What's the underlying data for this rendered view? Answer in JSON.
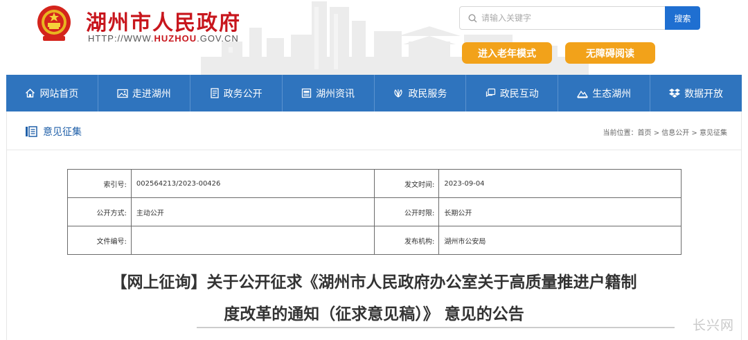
{
  "header": {
    "site_title": "湖州市人民政府",
    "url_prefix": "HTTP://WWW.",
    "url_domain": "HUZHOU",
    "url_suffix": ".GOV.CN",
    "search_placeholder": "请输入关键字",
    "search_button": "搜索",
    "elder_mode": "进入老年模式",
    "accessible_mode": "无障碍阅读",
    "brand_color": "#c8161d",
    "accent_color": "#f2a21a"
  },
  "nav": {
    "color": "#2f74be",
    "items": [
      {
        "label": "网站首页",
        "icon": "home-icon"
      },
      {
        "label": "走进湖州",
        "icon": "picture-icon"
      },
      {
        "label": "政务公开",
        "icon": "document-icon"
      },
      {
        "label": "湖州资讯",
        "icon": "news-icon"
      },
      {
        "label": "政民服务",
        "icon": "service-icon"
      },
      {
        "label": "政民互动",
        "icon": "chat-icon"
      },
      {
        "label": "生态湖州",
        "icon": "mountain-icon"
      },
      {
        "label": "数据开放",
        "icon": "dropbox-icon"
      }
    ]
  },
  "section": {
    "title": "意见征集",
    "breadcrumb": "当前位置：首页 > 信息公开 > 意见征集"
  },
  "meta_table": {
    "rows": [
      {
        "label1": "索引号:",
        "value1": "002564213/2023-00426",
        "label2": "发文时间:",
        "value2": "2023-09-04"
      },
      {
        "label1": "公开方式:",
        "value1": "主动公开",
        "label2": "公开时限:",
        "value2": "长期公开"
      },
      {
        "label1": "文件编号:",
        "value1": "",
        "label2": "发布机构:",
        "value2": "湖州市公安局"
      }
    ]
  },
  "document": {
    "title_line1": "【网上征询】关于公开征求《湖州市人民政府办公室关于高质量推进户籍制",
    "title_line2": "度改革的通知（征求意见稿）》 意见的公告"
  },
  "watermark": "长兴网"
}
